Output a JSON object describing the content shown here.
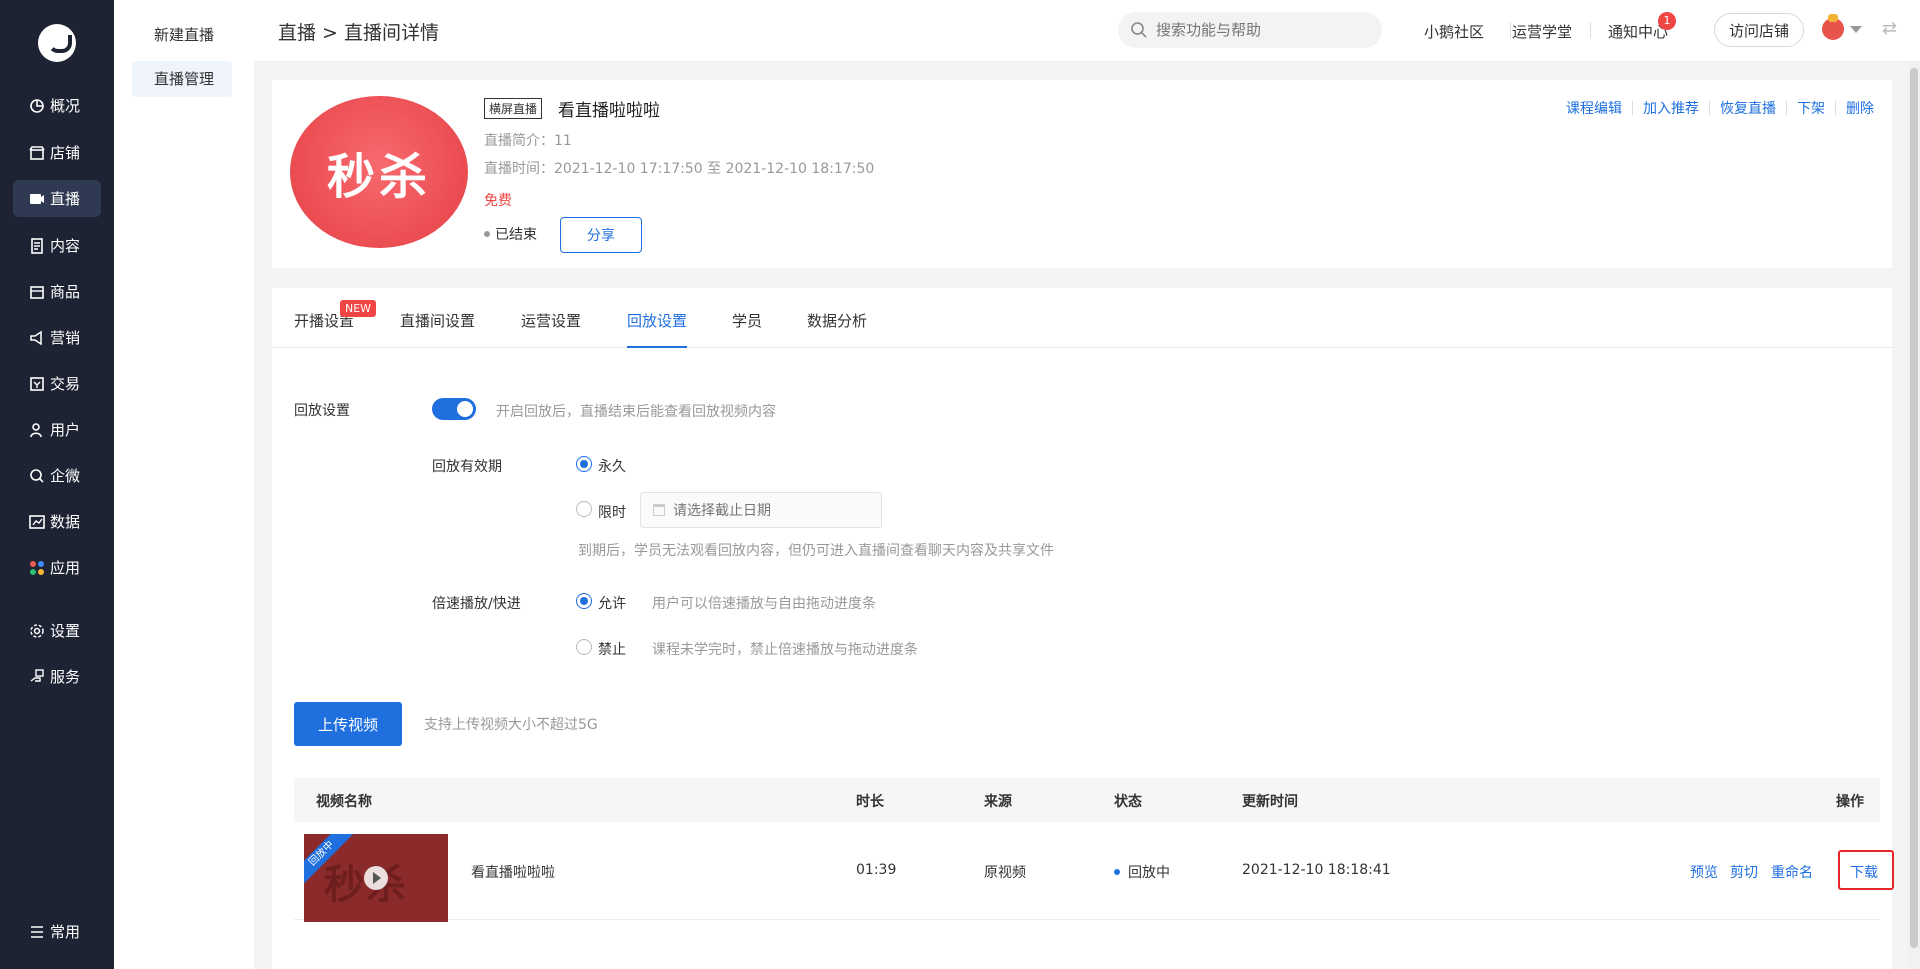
{
  "nav": {
    "items": [
      {
        "label": "概况",
        "icon": "dashboard-icon"
      },
      {
        "label": "店铺",
        "icon": "store-icon"
      },
      {
        "label": "直播",
        "icon": "live-icon"
      },
      {
        "label": "内容",
        "icon": "content-icon"
      },
      {
        "label": "商品",
        "icon": "product-icon"
      },
      {
        "label": "营销",
        "icon": "marketing-icon"
      },
      {
        "label": "交易",
        "icon": "trade-icon"
      },
      {
        "label": "用户",
        "icon": "user-icon"
      },
      {
        "label": "企微",
        "icon": "wecom-icon"
      },
      {
        "label": "数据",
        "icon": "data-icon"
      },
      {
        "label": "应用",
        "icon": "apps-icon"
      },
      {
        "label": "设置",
        "icon": "gear-icon"
      },
      {
        "label": "服务",
        "icon": "service-icon"
      }
    ],
    "bottom": {
      "label": "常用",
      "icon": "menu-icon"
    }
  },
  "subnav": {
    "items": [
      "新建直播",
      "直播管理"
    ]
  },
  "header": {
    "breadcrumb": "直播 > 直播间详情",
    "search_placeholder": "搜索功能与帮助",
    "links": [
      "小鹅社区",
      "运营学堂",
      "通知中心"
    ],
    "notify_count": "1",
    "visit_store": "访问店铺"
  },
  "course": {
    "cover_text": "秒杀",
    "tag": "横屏直播",
    "title": "看直播啦啦啦",
    "intro": "直播简介：11",
    "time": "直播时间：2021-12-10 17:17:50 至 2021-12-10 18:17:50",
    "price": "免费",
    "status": "已结束",
    "share": "分享",
    "actions": [
      "课程编辑",
      "加入推荐",
      "恢复直播",
      "下架",
      "删除"
    ]
  },
  "tabs": {
    "items": [
      "开播设置",
      "直播间设置",
      "运营设置",
      "回放设置",
      "学员",
      "数据分析"
    ],
    "new_badge": "NEW",
    "active": "回放设置"
  },
  "playback": {
    "label": "回放设置",
    "toggle_hint": "开启回放后，直播结束后能查看回放视频内容",
    "validity_label": "回放有效期",
    "forever": "永久",
    "limited": "限时",
    "date_placeholder": "请选择截止日期",
    "expire_hint": "到期后，学员无法观看回放内容，但仍可进入直播间查看聊天内容及共享文件",
    "speed_label": "倍速播放/快进",
    "allow": "允许",
    "allow_hint": "用户可以倍速播放与自由拖动进度条",
    "forbid": "禁止",
    "forbid_hint": "课程未学完时，禁止倍速播放与拖动进度条",
    "upload": "上传视频",
    "upload_hint": "支持上传视频大小不超过5G"
  },
  "table": {
    "headers": [
      "视频名称",
      "时长",
      "来源",
      "状态",
      "更新时间",
      "操作"
    ],
    "row": {
      "ribbon": "回放中",
      "thumb_text": "秒杀",
      "name": "看直播啦啦啦",
      "duration": "01:39",
      "source": "原视频",
      "status": "回放中",
      "updated": "2021-12-10 18:18:41",
      "ops": [
        "预览",
        "剪切",
        "重命名",
        "下载"
      ]
    }
  }
}
